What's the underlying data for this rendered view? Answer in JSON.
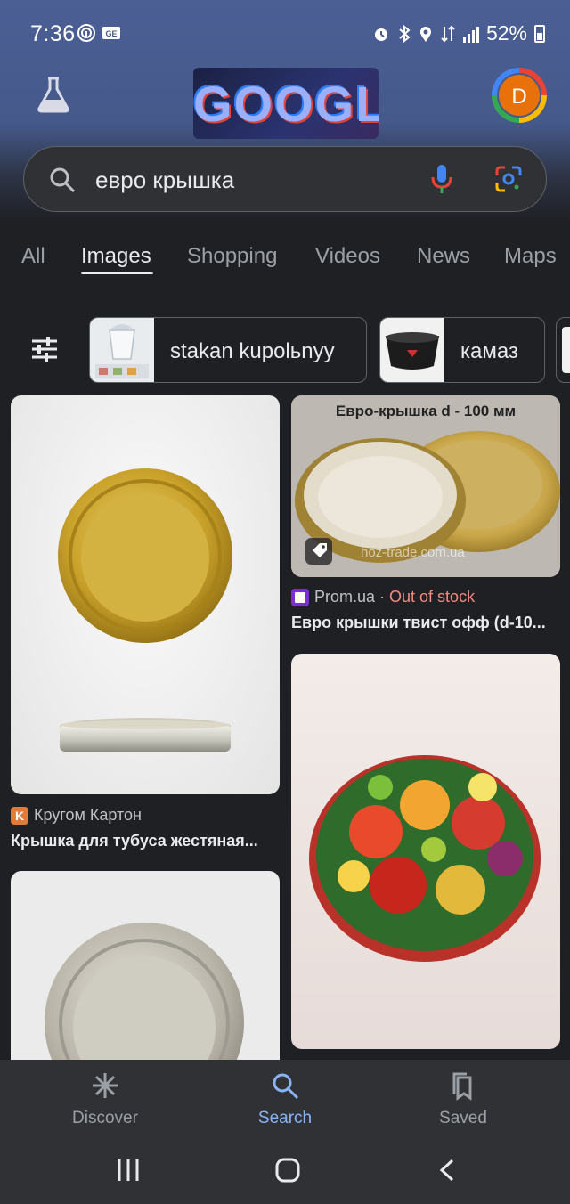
{
  "status": {
    "time": "7:36",
    "battery": "52%"
  },
  "header": {
    "doodle_text": "GOOGLE",
    "avatar_letter": "D"
  },
  "search": {
    "query": "евро крышка"
  },
  "tabs": [
    {
      "label": "All"
    },
    {
      "label": "Images"
    },
    {
      "label": "Shopping"
    },
    {
      "label": "Videos"
    },
    {
      "label": "News"
    },
    {
      "label": "Maps"
    }
  ],
  "chips": [
    {
      "label": "stakan kupolьnyy"
    },
    {
      "label": "камаз"
    }
  ],
  "results": [
    {
      "source": "Кругом Картон",
      "title": "Крышка для тубуса жестяная..."
    },
    {
      "banner": "Евро-крышка d - 100 мм",
      "watermark": "hoz-trade.com.ua",
      "source": "Prom.ua",
      "separator": " · ",
      "stock": "Out of stock",
      "title": "Евро крышки твист офф (d-10..."
    }
  ],
  "bottom_nav": [
    {
      "label": "Discover"
    },
    {
      "label": "Search"
    },
    {
      "label": "Saved"
    }
  ],
  "colors": {
    "accent": "#8ab4f8",
    "header_blue": "#4b5f95",
    "out_of_stock": "#f28b82"
  }
}
